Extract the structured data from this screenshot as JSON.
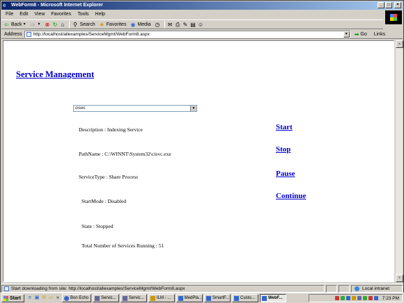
{
  "window": {
    "title": "WebForm8 - Microsoft Internet Explorer",
    "controls": [
      "_",
      "□",
      "×"
    ]
  },
  "menu": [
    "File",
    "Edit",
    "View",
    "Favorites",
    "Tools",
    "Help"
  ],
  "toolbar": {
    "back": "Back",
    "search": "Search",
    "favorites": "Favorites",
    "media": "Media"
  },
  "address": {
    "label": "Address",
    "url": "http://localhost/allexamples/ServiceMgmt/WebForm8.aspx",
    "go": "Go",
    "links": "Links"
  },
  "page": {
    "title": "Service Management",
    "selected_service": "cisvc",
    "description": "Description : Indexing Service",
    "pathname": "PathName : C:\\WINNT\\System32\\cisvc.exe",
    "service_type": "ServiceType : Share Process",
    "start_mode": "StartMode : Disabled",
    "state": "State : Stopped",
    "total_running": "Total Number of Services Running : 51",
    "actions": {
      "start": "Start",
      "stop": "Stop",
      "pause": "Pause",
      "continue": "Continue"
    }
  },
  "status": {
    "text": "Start downloading from site: http://localhost/allexamples/ServiceMgmt/WebForm8.aspx",
    "zone": "Local intranet"
  },
  "taskbar": {
    "start": "Start",
    "tasks": [
      "Bon Echo",
      "Servic...",
      "Servic...",
      "ILM - ...",
      "MedPla...",
      "SmartF...",
      "Custo...",
      "WebF..."
    ],
    "clock": "7:23 PM"
  },
  "colors": {
    "link": "#0000cc",
    "title_bar_start": "#0a246a",
    "chrome": "#d4d0c8"
  }
}
